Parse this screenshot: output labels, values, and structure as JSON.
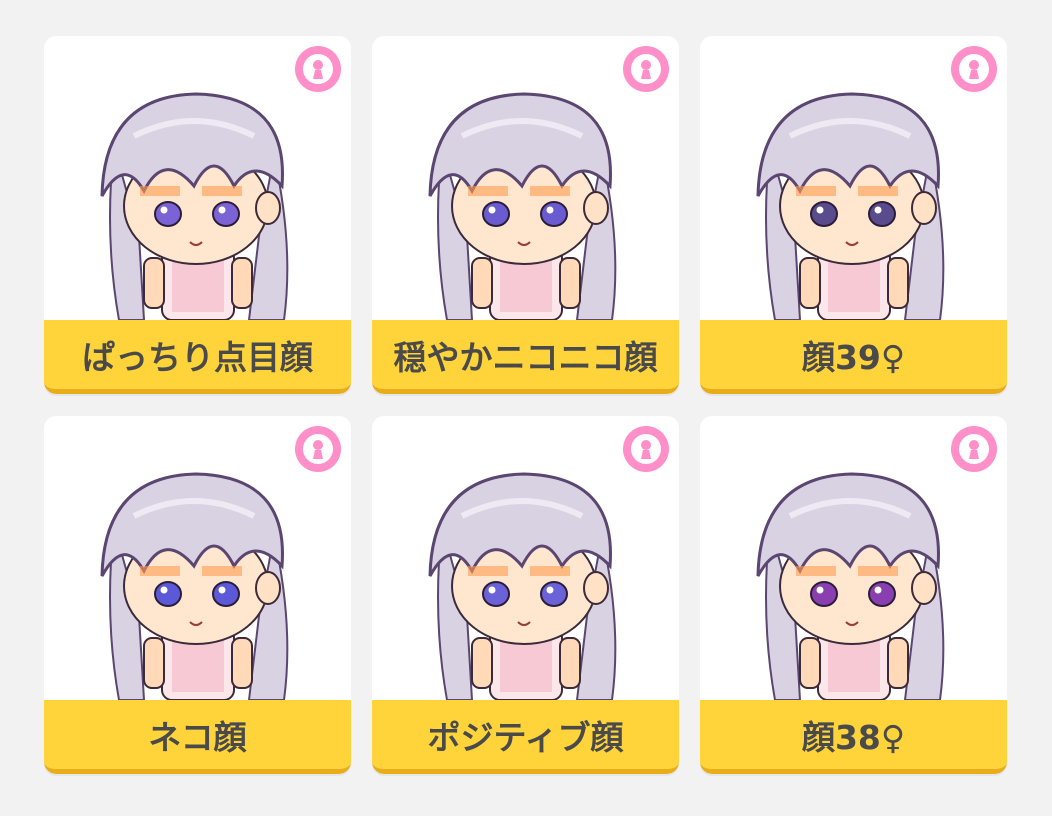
{
  "colors": {
    "page_background": "#f2f2f2",
    "card_background": "#ffffff",
    "name_bar": "#ffd43b",
    "name_bar_shadow": "#e8ad1a",
    "label_text": "#4a4a4a",
    "badge": "#ff8fc8"
  },
  "faces": [
    {
      "name": "ぱっちり点目顔",
      "badge_icon": "female-icon",
      "eye_color": "#7b63d6"
    },
    {
      "name": "穏やかニコニコ顔",
      "badge_icon": "female-icon",
      "eye_color": "#6a5cd0"
    },
    {
      "name": "顔39♀",
      "badge_icon": "female-icon",
      "eye_color": "#5a4b8c"
    },
    {
      "name": "ネコ顔",
      "badge_icon": "female-icon",
      "eye_color": "#5b59d8"
    },
    {
      "name": "ポジティブ顔",
      "badge_icon": "female-icon",
      "eye_color": "#6a62d6"
    },
    {
      "name": "顔38♀",
      "badge_icon": "female-icon",
      "eye_color": "#8a3fb0"
    }
  ]
}
